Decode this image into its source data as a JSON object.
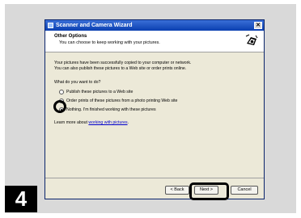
{
  "step_number": "4",
  "window": {
    "title": "Scanner and Camera Wizard",
    "close_glyph": "✕"
  },
  "header": {
    "title": "Other Options",
    "subtitle": "You can choose to keep working with your pictures."
  },
  "body": {
    "info_line1": "Your pictures have been successfully copied to your computer or network.",
    "info_line2": "You can also publish these pictures to a Web site or order prints online.",
    "question": "What do you want to do?",
    "options": [
      {
        "label": "Publish these pictures to a Web site",
        "selected": false
      },
      {
        "label": "Order prints of these pictures from a photo printing Web site",
        "selected": false
      },
      {
        "label": "Nothing. I'm finished working with these pictures",
        "selected": true
      }
    ],
    "learn_more_prefix": "Learn more about ",
    "learn_more_link": "working with pictures",
    "learn_more_suffix": "."
  },
  "buttons": {
    "back": "< Back",
    "next": "Next >",
    "cancel": "Cancel"
  },
  "icons": {
    "title": "scanner-camera-icon",
    "header": "wizard-camera-icon"
  }
}
